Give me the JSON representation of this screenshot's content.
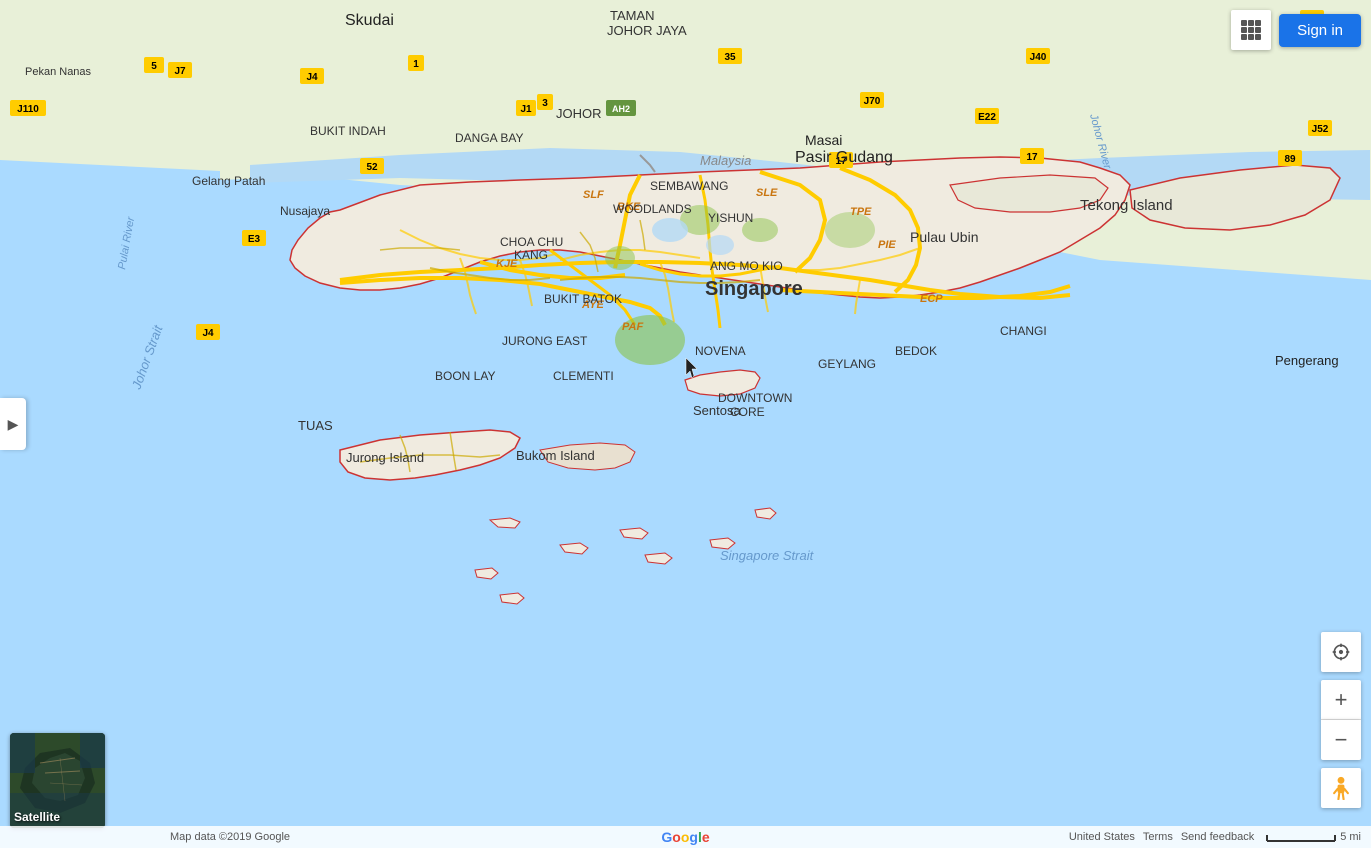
{
  "header": {
    "sign_in_label": "Sign in"
  },
  "left_toggle": {
    "aria_label": "Expand sidebar",
    "icon": "▶"
  },
  "satellite_thumbnail": {
    "label": "Satellite"
  },
  "bottom_bar": {
    "map_data": "Map data ©2019 Google",
    "united_states": "United States",
    "terms": "Terms",
    "send_feedback": "Send feedback",
    "scale": "5 mi"
  },
  "zoom_controls": {
    "zoom_in": "+",
    "zoom_out": "−"
  },
  "map": {
    "center_label": "Singapore",
    "regions": [
      "WOODLANDS",
      "YISHUN",
      "CHOA CHU KANG",
      "BUKIT BATOK",
      "ANG MO KIO",
      "JURONG EAST",
      "BOON LAY",
      "CLEMENTI",
      "NOVENA",
      "GEYLANG",
      "BEDOK",
      "CHANGI",
      "DOWNTOWN CORE",
      "Sentosa",
      "Jurong Island",
      "Bukom Island"
    ],
    "highways": [
      "SLE",
      "BKE",
      "KJE",
      "PIE",
      "AYE",
      "ECP",
      "TPE",
      "SLF",
      "PAF"
    ],
    "malaysia_labels": [
      "SEMBAWANG",
      "WOODLANDS",
      "YISHUN",
      "Skudai",
      "JOHOR",
      "TAMAN JOHOR JAYA",
      "Masai",
      "Pasir Gudang",
      "Nusajaya",
      "Gelang Patah",
      "Pekan Nanas",
      "BUKIT INDAH",
      "DANGA BAY"
    ],
    "islands": [
      "Pulau Ubin",
      "Tekong Island",
      "Pengerang"
    ],
    "water": [
      "Johor Strait",
      "Singapore Strait"
    ]
  }
}
